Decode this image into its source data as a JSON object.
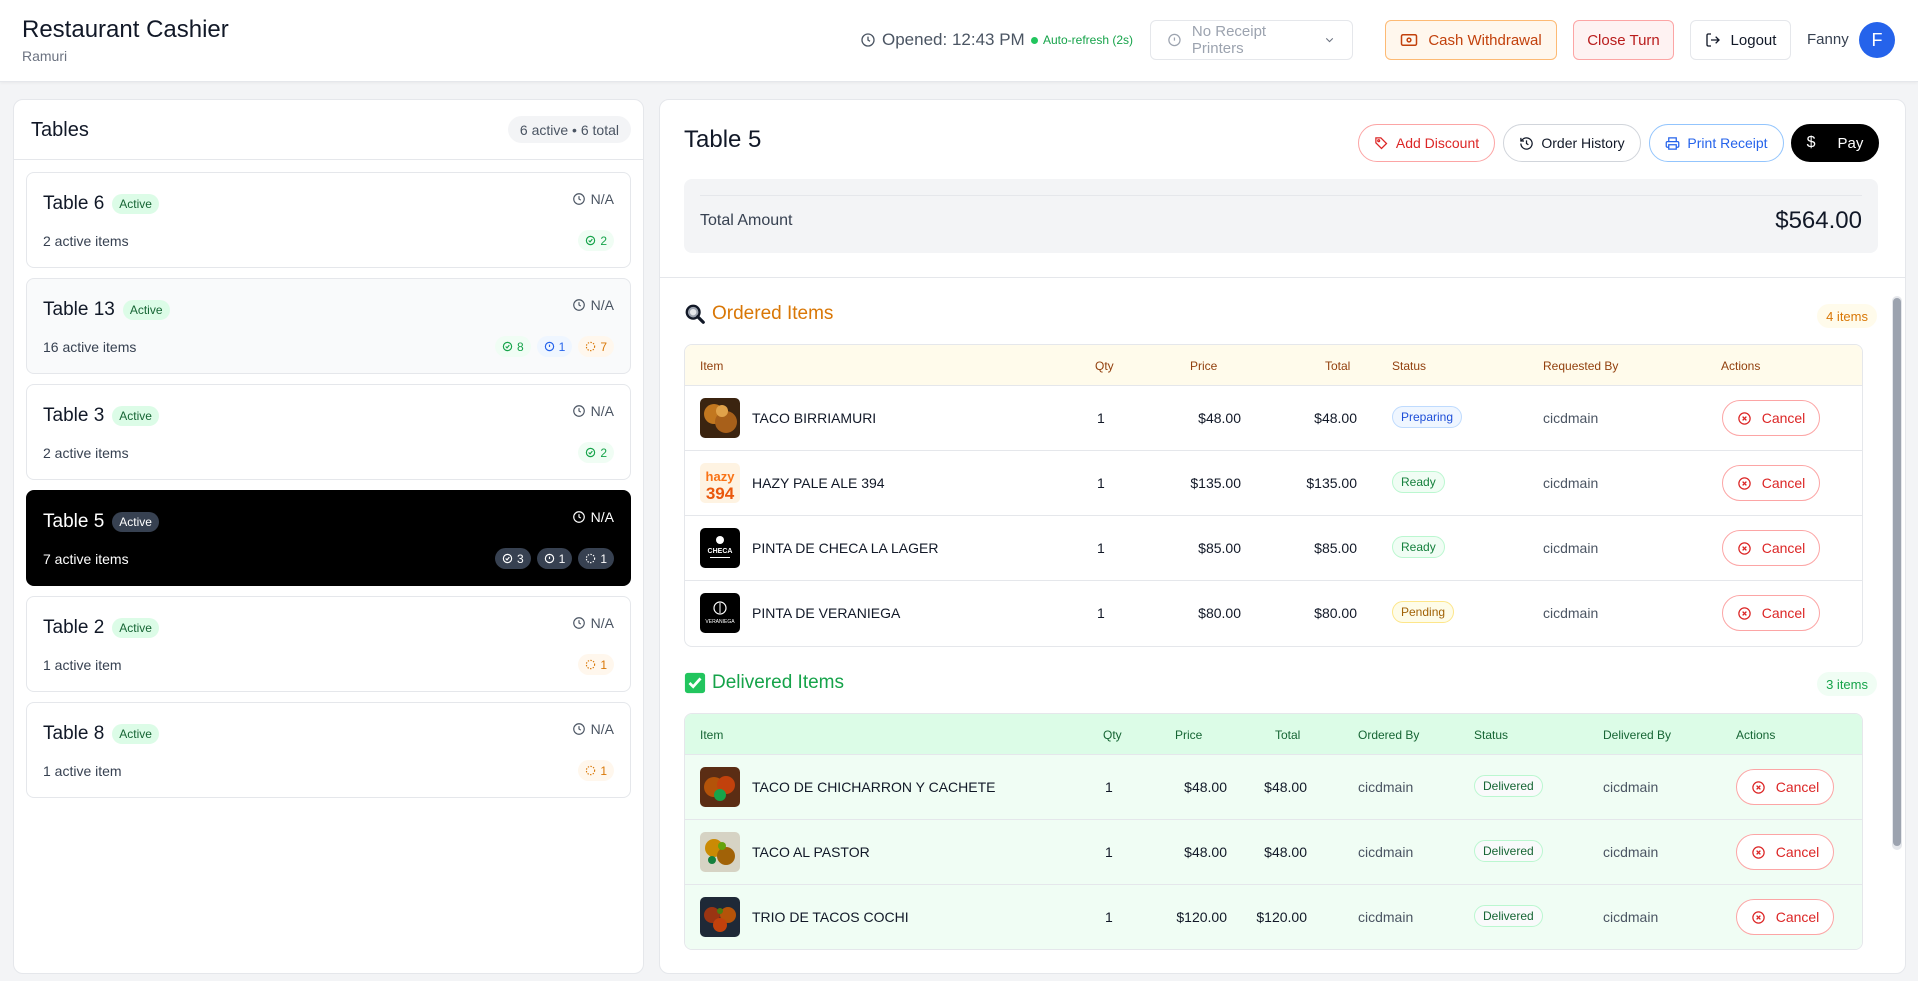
{
  "app": {
    "title": "Restaurant Cashier",
    "subtitle": "Ramuri"
  },
  "header": {
    "opened": "Opened: 12:43 PM",
    "auto_refresh": "Auto-refresh (2s)",
    "printer_select": "No Receipt Printers",
    "cash_withdrawal": "Cash Withdrawal",
    "close_turn": "Close Turn",
    "logout": "Logout",
    "user_name": "Fanny",
    "user_initial": "F"
  },
  "tables_panel": {
    "title": "Tables",
    "summary": "6 active • 6 total",
    "tables": [
      {
        "name": "Table 6",
        "badge": "Active",
        "time": "N/A",
        "items": "2 active items",
        "chips": {
          "ready": "2"
        }
      },
      {
        "name": "Table 13",
        "badge": "Active",
        "time": "N/A",
        "items": "16 active items",
        "chips": {
          "ready": "8",
          "info": "1",
          "pending": "7"
        }
      },
      {
        "name": "Table 3",
        "badge": "Active",
        "time": "N/A",
        "items": "2 active items",
        "chips": {
          "ready": "2"
        }
      },
      {
        "name": "Table 5",
        "badge": "Active",
        "time": "N/A",
        "items": "7 active items",
        "chips": {
          "ready": "3",
          "info": "1",
          "pending": "1"
        }
      },
      {
        "name": "Table 2",
        "badge": "Active",
        "time": "N/A",
        "items": "1 active item",
        "chips": {
          "pending": "1"
        }
      },
      {
        "name": "Table 8",
        "badge": "Active",
        "time": "N/A",
        "items": "1 active item",
        "chips": {
          "pending": "1"
        }
      }
    ]
  },
  "detail": {
    "title": "Table 5",
    "add_discount": "Add Discount",
    "order_history": "Order History",
    "print_receipt": "Print Receipt",
    "pay": "Pay",
    "total_label": "Total Amount",
    "total_value": "$564.00",
    "ordered": {
      "title": "Ordered Items",
      "count": "4 items",
      "columns": [
        "Item",
        "Qty",
        "Price",
        "Total",
        "Status",
        "Requested By",
        "Actions"
      ],
      "rows": [
        {
          "item": "TACO BIRRIAMURI",
          "qty": "1",
          "price": "$48.00",
          "total": "$48.00",
          "status": "Preparing",
          "requested_by": "cicdmain",
          "action": "Cancel"
        },
        {
          "item": "HAZY PALE ALE 394",
          "qty": "1",
          "price": "$135.00",
          "total": "$135.00",
          "status": "Ready",
          "requested_by": "cicdmain",
          "action": "Cancel"
        },
        {
          "item": "PINTA DE CHECA LA LAGER",
          "qty": "1",
          "price": "$85.00",
          "total": "$85.00",
          "status": "Ready",
          "requested_by": "cicdmain",
          "action": "Cancel"
        },
        {
          "item": "PINTA DE VERANIEGA",
          "qty": "1",
          "price": "$80.00",
          "total": "$80.00",
          "status": "Pending",
          "requested_by": "cicdmain",
          "action": "Cancel"
        }
      ]
    },
    "delivered": {
      "title": "Delivered Items",
      "count": "3 items",
      "columns": [
        "Item",
        "Qty",
        "Price",
        "Total",
        "Ordered By",
        "Status",
        "Delivered By",
        "Actions"
      ],
      "rows": [
        {
          "item": "TACO DE CHICHARRON Y CACHETE",
          "qty": "1",
          "price": "$48.00",
          "total": "$48.00",
          "ordered_by": "cicdmain",
          "status": "Delivered",
          "delivered_by": "cicdmain",
          "action": "Cancel"
        },
        {
          "item": "TACO AL PASTOR",
          "qty": "1",
          "price": "$48.00",
          "total": "$48.00",
          "ordered_by": "cicdmain",
          "status": "Delivered",
          "delivered_by": "cicdmain",
          "action": "Cancel"
        },
        {
          "item": "TRIO DE TACOS COCHI",
          "qty": "1",
          "price": "$120.00",
          "total": "$120.00",
          "ordered_by": "cicdmain",
          "status": "Delivered",
          "delivered_by": "cicdmain",
          "action": "Cancel"
        }
      ]
    }
  },
  "thumb_logos": {
    "hazy": "hazy 394",
    "checa": "CHECA",
    "veraniega": "VERANIEGA"
  },
  "colors": {
    "accent": "#2563eb",
    "ordered": "#d97706",
    "delivered": "#16a34a",
    "danger": "#dc2626"
  }
}
